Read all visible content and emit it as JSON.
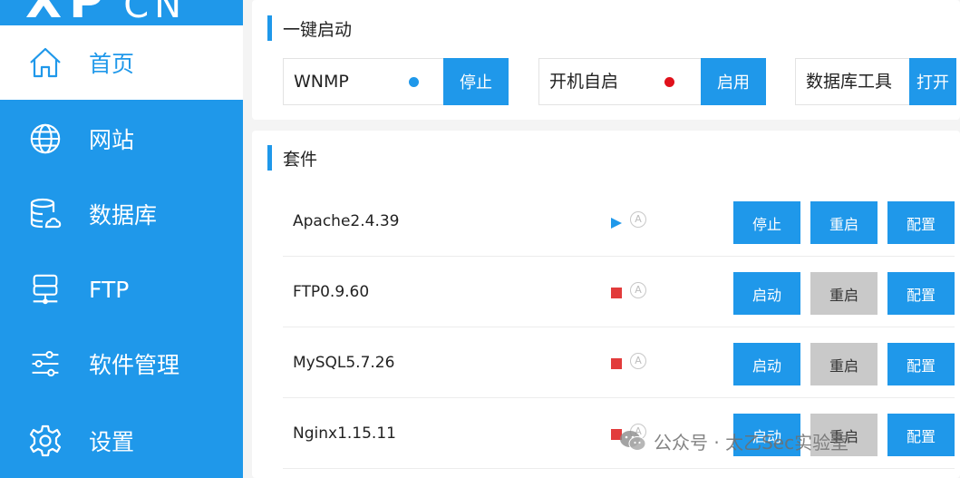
{
  "sidebar": {
    "logo": "XP",
    "logo_suffix": "CN",
    "items": [
      {
        "label": "首页",
        "icon": "home-icon",
        "active": true
      },
      {
        "label": "网站",
        "icon": "globe-icon"
      },
      {
        "label": "数据库",
        "icon": "database-icon"
      },
      {
        "label": "FTP",
        "icon": "ftp-server-icon"
      },
      {
        "label": "软件管理",
        "icon": "sliders-icon"
      },
      {
        "label": "设置",
        "icon": "gear-icon"
      }
    ]
  },
  "quick_start": {
    "title": "一键启动",
    "items": [
      {
        "label": "WNMP",
        "status_color": "#1f98ea",
        "button": "停止"
      },
      {
        "label": "开机自启",
        "status_color": "#e0111b",
        "button": "启用"
      },
      {
        "label": "数据库工具",
        "button": "打开"
      }
    ]
  },
  "suite": {
    "title": "套件",
    "auto_symbol": "A",
    "rows": [
      {
        "name": "Apache2.4.39",
        "status": "running",
        "status_color": "#1f98ea",
        "btn1": "停止",
        "btn2": "重启",
        "btn3": "配置",
        "btn2_enabled": true
      },
      {
        "name": "FTP0.9.60",
        "status": "stopped",
        "status_color": "#e23b3b",
        "btn1": "启动",
        "btn2": "重启",
        "btn3": "配置",
        "btn2_enabled": false
      },
      {
        "name": "MySQL5.7.26",
        "status": "stopped",
        "status_color": "#e23b3b",
        "btn1": "启动",
        "btn2": "重启",
        "btn3": "配置",
        "btn2_enabled": false
      },
      {
        "name": "Nginx1.15.11",
        "status": "stopped",
        "status_color": "#e23b3b",
        "btn1": "启动",
        "btn2": "重启",
        "btn3": "配置",
        "btn2_enabled": false
      }
    ]
  },
  "watermark": {
    "text": "公众号 · 太乙Sec实验室",
    "icon": "wechat-icon"
  },
  "colors": {
    "accent": "#1f98ea",
    "disabled": "#c9c9c9",
    "stopped": "#e23b3b"
  }
}
